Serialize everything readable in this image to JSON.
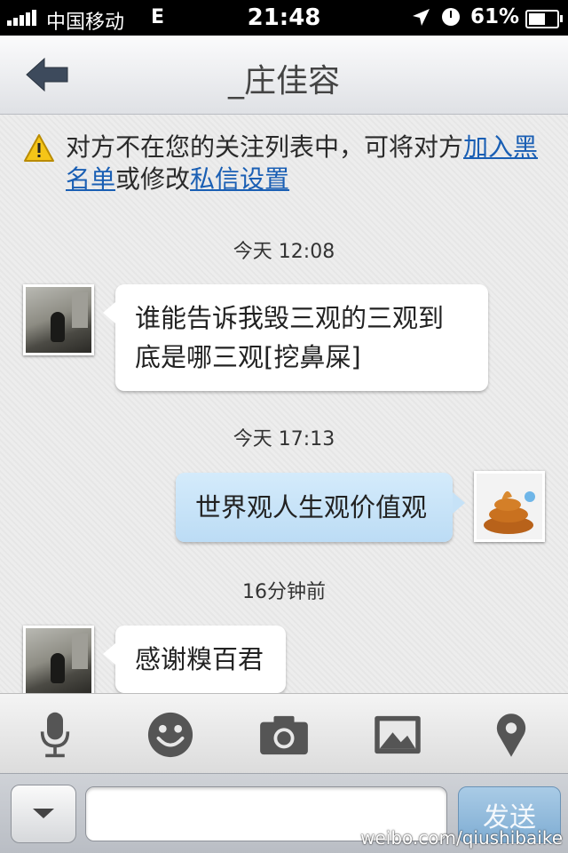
{
  "status_bar": {
    "carrier": "中国移动",
    "network": "E",
    "time": "21:48",
    "battery_percent_text": "61%",
    "battery_level": 0.61
  },
  "nav": {
    "back_icon": "back-arrow-icon",
    "title": "_庄佳容"
  },
  "notice": {
    "icon": "warning-icon",
    "text_before": "对方不在您的关注列表中，可将对方",
    "link_blacklist": "加入黑名单",
    "text_middle": "或修改",
    "link_privacy": "私信设置"
  },
  "messages": [
    {
      "timestamp": "今天 12:08",
      "direction": "incoming",
      "text": "谁能告诉我毁三观的三观到底是哪三观[挖鼻屎]"
    },
    {
      "timestamp": "今天 17:13",
      "direction": "outgoing",
      "text": "世界观人生观价值观"
    },
    {
      "timestamp": "16分钟前",
      "direction": "incoming",
      "text": "感谢糗百君"
    }
  ],
  "toolbar": {
    "icons": [
      "microphone-icon",
      "emoji-icon",
      "camera-icon",
      "image-icon",
      "location-icon"
    ]
  },
  "input_bar": {
    "input_value": "",
    "send_label": "发送"
  },
  "watermark": "weibo.com/qiushibaike",
  "colors": {
    "link": "#1a5fb4",
    "outgoing_bubble": "#c6e2f7",
    "send_button": "#7fadd3"
  }
}
